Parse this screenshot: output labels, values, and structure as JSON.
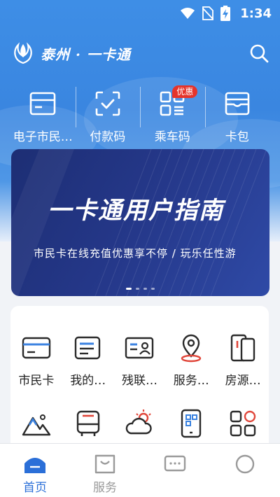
{
  "status_bar": {
    "time": "1:34"
  },
  "header": {
    "app_title": "泰州 · 一卡通"
  },
  "quick_actions": [
    {
      "label": "电子市民…"
    },
    {
      "label": "付款码"
    },
    {
      "label": "乘车码",
      "badge": "优惠"
    },
    {
      "label": "卡包"
    }
  ],
  "banner": {
    "title": "一卡通用户指南",
    "subtitle": "市民卡在线充值优惠享不停 / 玩乐任性游",
    "page_count": 4,
    "active_index": 0
  },
  "services": [
    {
      "label": "市民卡"
    },
    {
      "label": "我的…"
    },
    {
      "label": "残联…"
    },
    {
      "label": "服务…"
    },
    {
      "label": "房源…"
    }
  ],
  "tabs": [
    {
      "label": "首页",
      "active": true
    },
    {
      "label": "服务",
      "active": false
    }
  ],
  "colors": {
    "accent": "#2b6fd8",
    "badge": "#e5342b",
    "map_pin": "#e0463a"
  }
}
